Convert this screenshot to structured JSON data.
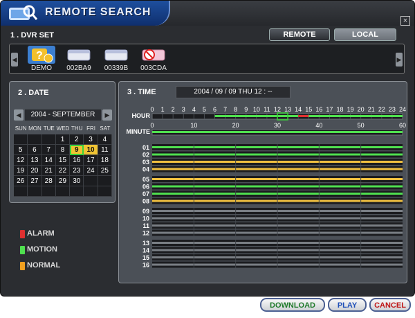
{
  "window": {
    "title": "REMOTE SEARCH",
    "close_label": "×"
  },
  "dvr_set": {
    "label": "1 . DVR SET",
    "mode_buttons": {
      "remote": "REMOTE",
      "local": "LOCAL"
    },
    "items": [
      {
        "name": "DEMO",
        "selected": true
      },
      {
        "name": "002BA9",
        "selected": false
      },
      {
        "name": "00339B",
        "selected": false
      },
      {
        "name": "003CDA",
        "selected": false
      }
    ]
  },
  "date": {
    "label": "2 . DATE",
    "month_title": "2004 - SEPTEMBER",
    "weekdays": [
      "SUN",
      "MON",
      "TUE",
      "WED",
      "THU",
      "FRI",
      "SAT"
    ],
    "days": [
      "",
      "",
      "",
      "1",
      "2",
      "3",
      "4",
      "5",
      "6",
      "7",
      "8",
      "9",
      "10",
      "11",
      "12",
      "13",
      "14",
      "15",
      "16",
      "17",
      "18",
      "19",
      "20",
      "21",
      "22",
      "23",
      "24",
      "25",
      "26",
      "27",
      "28",
      "29",
      "30",
      "",
      "",
      "",
      "",
      "",
      "",
      "",
      "",
      ""
    ],
    "days_with_data": [
      "10"
    ],
    "selected_day": "9"
  },
  "legend": [
    {
      "label": "ALARM",
      "color": "#e03030"
    },
    {
      "label": "MOTION",
      "color": "#4fe04f"
    },
    {
      "label": "NORMAL",
      "color": "#f0a020"
    }
  ],
  "time": {
    "label": "3 . TIME",
    "display": "2004 / 09 / 09  THU  12 : --",
    "hour_label": "HOUR",
    "minute_label": "MINUTE",
    "hour_ticks": [
      "0",
      "1",
      "2",
      "3",
      "4",
      "5",
      "6",
      "7",
      "8",
      "9",
      "10",
      "11",
      "12",
      "13",
      "14",
      "15",
      "16",
      "17",
      "18",
      "19",
      "20",
      "21",
      "22",
      "23",
      "24"
    ],
    "minute_ticks": [
      "0",
      "10",
      "20",
      "30",
      "40",
      "50",
      "60"
    ],
    "selected_hour": 12,
    "hour_segments": [
      {
        "from": 6,
        "to": 14,
        "type": "motion"
      },
      {
        "from": 14,
        "to": 15,
        "type": "alarm"
      },
      {
        "from": 15,
        "to": 24,
        "type": "motion"
      }
    ],
    "minute_bar": "motion",
    "channels": [
      "01",
      "02",
      "03",
      "04",
      "05",
      "06",
      "07",
      "08",
      "09",
      "10",
      "11",
      "12",
      "13",
      "14",
      "15",
      "16"
    ],
    "channel_records": [
      "motion",
      "motion",
      "normal",
      "normal",
      "normal",
      "motion",
      "motion",
      "normal",
      "",
      "",
      "",
      "",
      "",
      "",
      "",
      ""
    ]
  },
  "colors": {
    "motion": "#4fe04f",
    "alarm": "#e03030",
    "normal": "#f0c040",
    "empty": "#7a7f85"
  },
  "buttons": {
    "download": "DOWNLOAD",
    "play": "PLAY",
    "cancel": "CANCEL"
  }
}
